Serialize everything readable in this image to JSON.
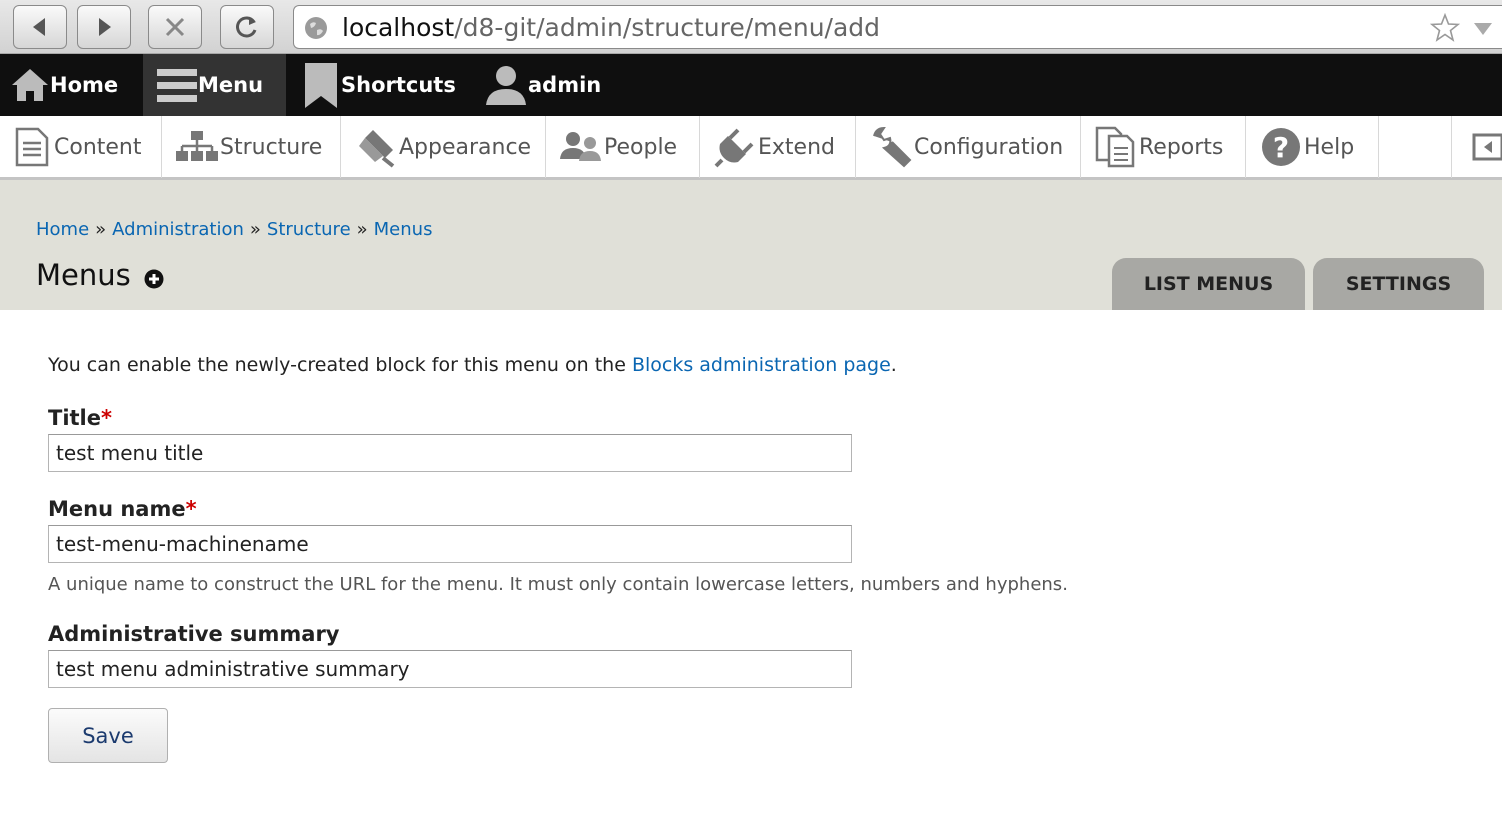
{
  "browser": {
    "url_host": "localhost",
    "url_path": "/d8-git/admin/structure/menu/add"
  },
  "toolbar": {
    "items": [
      {
        "label": "Home",
        "icon": "home-icon"
      },
      {
        "label": "Menu",
        "icon": "hamburger-icon"
      },
      {
        "label": "Shortcuts",
        "icon": "bookmark-icon"
      },
      {
        "label": "admin",
        "icon": "user-icon"
      }
    ]
  },
  "tray": {
    "items": [
      {
        "label": "Content",
        "icon": "document-icon"
      },
      {
        "label": "Structure",
        "icon": "sitemap-icon"
      },
      {
        "label": "Appearance",
        "icon": "paintbrush-icon"
      },
      {
        "label": "People",
        "icon": "people-icon"
      },
      {
        "label": "Extend",
        "icon": "plug-icon"
      },
      {
        "label": "Configuration",
        "icon": "wrench-icon"
      },
      {
        "label": "Reports",
        "icon": "reports-icon"
      },
      {
        "label": "Help",
        "icon": "help-icon"
      }
    ]
  },
  "breadcrumb": {
    "items": [
      "Home",
      "Administration",
      "Structure",
      "Menus"
    ],
    "separator": "»"
  },
  "page": {
    "title": "Menus",
    "tabs": [
      "LIST MENUS",
      "SETTINGS"
    ]
  },
  "form": {
    "intro_text": "You can enable the newly-created block for this menu on the ",
    "intro_link": "Blocks administration page",
    "intro_end": ".",
    "title_label": "Title",
    "title_value": "test menu title",
    "menu_name_label": "Menu name",
    "menu_name_value": "test-menu-machinename",
    "menu_name_desc": "A unique name to construct the URL for the menu. It must only contain lowercase letters, numbers and hyphens.",
    "summary_label": "Administrative summary",
    "summary_value": "test menu administrative summary",
    "required_mark": "*",
    "save_label": "Save"
  },
  "colors": {
    "link": "#0a66b2",
    "toolbar_bg": "#0f0f0f",
    "header_bg": "#e0e0d8",
    "required": "#cc0000"
  }
}
